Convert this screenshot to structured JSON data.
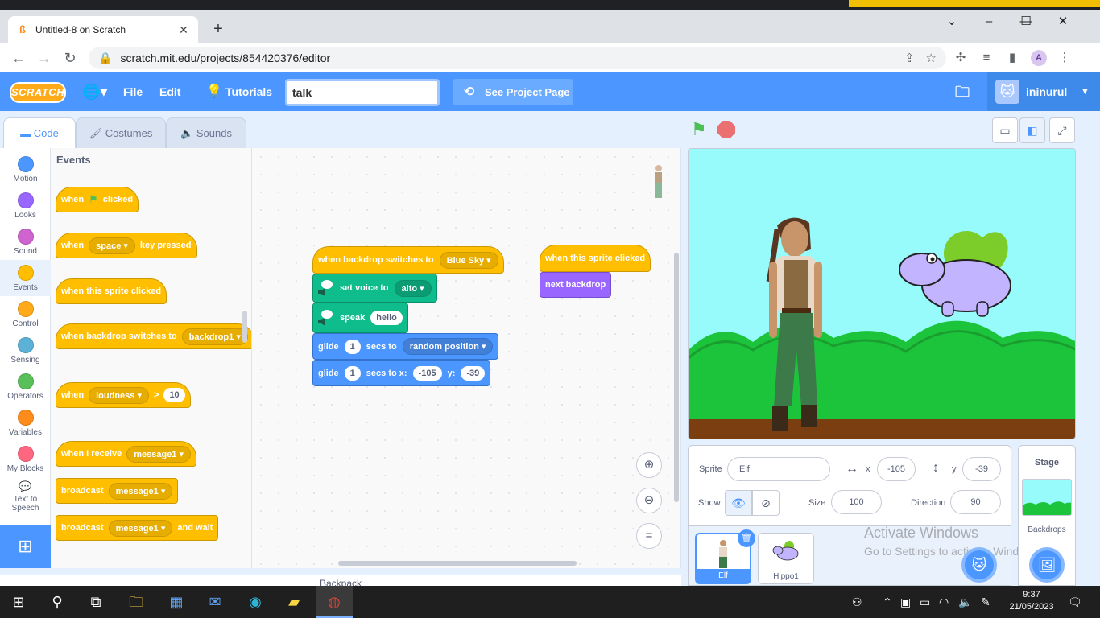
{
  "browser": {
    "tab_title": "Untitled-8 on Scratch",
    "url": "scratch.mit.edu/projects/854420376/editor"
  },
  "menubar": {
    "logo": "SCRATCH",
    "file": "File",
    "edit": "Edit",
    "tutorials": "Tutorials",
    "search_value": "talk",
    "see_project": "See Project Page",
    "username": "ininurul"
  },
  "tabs": {
    "code": "Code",
    "costumes": "Costumes",
    "sounds": "Sounds"
  },
  "categories": [
    {
      "label": "Motion",
      "color": "#4c97ff"
    },
    {
      "label": "Looks",
      "color": "#9966ff"
    },
    {
      "label": "Sound",
      "color": "#cf63cf"
    },
    {
      "label": "Events",
      "color": "#ffbf00"
    },
    {
      "label": "Control",
      "color": "#ffab19"
    },
    {
      "label": "Sensing",
      "color": "#5cb1d6"
    },
    {
      "label": "Operators",
      "color": "#59c059"
    },
    {
      "label": "Variables",
      "color": "#ff8c1a"
    },
    {
      "label": "My Blocks",
      "color": "#ff6680"
    },
    {
      "label": "Text to Speech",
      "color": "#0fbd8c"
    }
  ],
  "flyout": {
    "title": "Events",
    "when": "when",
    "clicked": "clicked",
    "space": "space",
    "key_pressed": "key pressed",
    "sprite_clicked": "when this sprite clicked",
    "backdrop_switches": "when backdrop switches to",
    "backdrop1": "backdrop1",
    "loudness": "loudness",
    "gt": ">",
    "loud_value": "10",
    "receive": "when I receive",
    "message1": "message1",
    "broadcast": "broadcast",
    "and_wait": "and wait"
  },
  "script1": {
    "hat": "when backdrop switches to",
    "hat_value": "Blue Sky",
    "set_voice": "set voice to",
    "voice": "alto",
    "speak": "speak",
    "speak_text": "hello",
    "glide": "glide",
    "secs_to": "secs to",
    "glide_secs": "1",
    "random_position": "random position",
    "secs_to_x": "secs to x:",
    "x": "-105",
    "y_label": "y:",
    "y": "-39"
  },
  "script2": {
    "hat": "when this sprite clicked",
    "next_backdrop": "next backdrop"
  },
  "sprite_info": {
    "sprite_label": "Sprite",
    "sprite_name": "Elf",
    "x_label": "x",
    "x": "-105",
    "y_label": "y",
    "y": "-39",
    "show_label": "Show",
    "size_label": "Size",
    "size": "100",
    "direction_label": "Direction",
    "direction": "90"
  },
  "sprites": [
    {
      "name": "Elf"
    },
    {
      "name": "Hippo1"
    }
  ],
  "stage_panel": {
    "title": "Stage",
    "backdrops": "Backdrops"
  },
  "backpack": "Backpack",
  "watermark": {
    "line1": "Activate Windows",
    "line2": "Go to Settings to activate Windows."
  },
  "taskbar": {
    "time": "9:37",
    "date": "21/05/2023"
  }
}
